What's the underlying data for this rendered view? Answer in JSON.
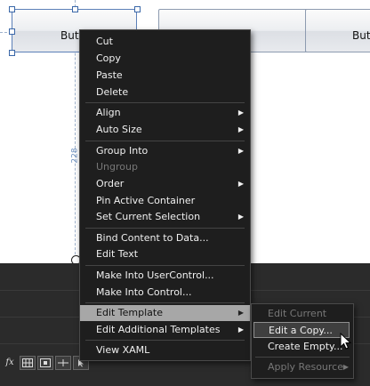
{
  "canvas": {
    "button1_label": "Butt",
    "button3_label": "Butt",
    "height_label": "228"
  },
  "context_menu": {
    "items": [
      {
        "label": "Cut"
      },
      {
        "label": "Copy"
      },
      {
        "label": "Paste"
      },
      {
        "label": "Delete"
      },
      {
        "label": "Align"
      },
      {
        "label": "Auto Size"
      },
      {
        "label": "Group Into"
      },
      {
        "label": "Ungroup"
      },
      {
        "label": "Order"
      },
      {
        "label": "Pin Active Container"
      },
      {
        "label": "Set Current Selection"
      },
      {
        "label": "Bind Content to Data..."
      },
      {
        "label": "Edit Text"
      },
      {
        "label": "Make Into UserControl..."
      },
      {
        "label": "Make Into Control..."
      },
      {
        "label": "Edit Template"
      },
      {
        "label": "Edit Additional Templates"
      },
      {
        "label": "View XAML"
      }
    ]
  },
  "submenu": {
    "items": [
      {
        "label": "Edit Current"
      },
      {
        "label": "Edit a Copy..."
      },
      {
        "label": "Create Empty..."
      },
      {
        "label": "Apply Resource"
      }
    ]
  },
  "toolbar": {
    "fx_label": "fx",
    "grid_icon": "grid-icon",
    "snap_icon": "snap-grid-icon",
    "pin_icon": "pin-icon",
    "arrow_icon": "cursor-icon"
  }
}
